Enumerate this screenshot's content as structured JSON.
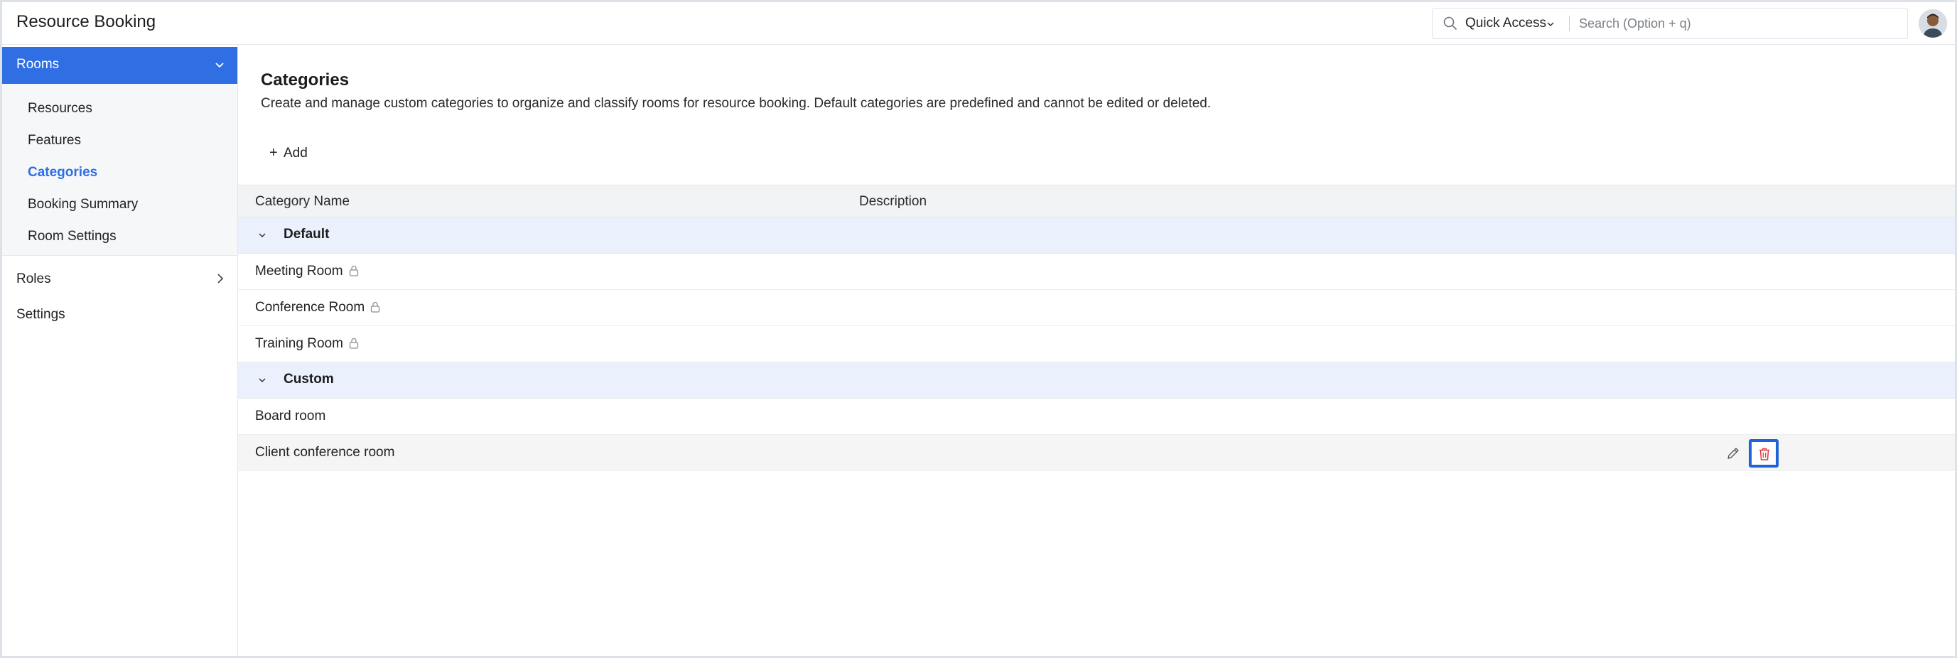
{
  "app": {
    "title": "Resource Booking"
  },
  "header": {
    "quick_access_label": "Quick Access",
    "search_placeholder": "Search (Option + q)"
  },
  "sidebar": {
    "active_section": "Rooms",
    "sub_items": [
      {
        "label": "Resources"
      },
      {
        "label": "Features"
      },
      {
        "label": "Categories",
        "active": true
      },
      {
        "label": "Booking Summary"
      },
      {
        "label": "Room Settings"
      }
    ],
    "items": [
      {
        "label": "Roles"
      },
      {
        "label": "Settings"
      }
    ]
  },
  "main": {
    "title": "Categories",
    "description": "Create and manage custom categories to organize and classify rooms for resource booking. Default categories are predefined and cannot be edited or deleted.",
    "add_label": "Add",
    "table": {
      "columns": [
        "Category Name",
        "Description"
      ],
      "groups": [
        {
          "label": "Default",
          "rows": [
            {
              "name": "Meeting Room",
              "description": "",
              "locked": true
            },
            {
              "name": "Conference Room",
              "description": "",
              "locked": true
            },
            {
              "name": "Training Room",
              "description": "",
              "locked": true
            }
          ]
        },
        {
          "label": "Custom",
          "rows": [
            {
              "name": "Board room",
              "description": "",
              "locked": false
            },
            {
              "name": "Client conference room",
              "description": "",
              "locked": false
            }
          ]
        }
      ]
    }
  },
  "colors": {
    "accent": "#2f6ee3",
    "group_row_bg": "#eaf1fc",
    "delete_icon": "#e0393e",
    "focus_border": "#1f63d6"
  },
  "icons": {
    "search": "search-icon",
    "chevron": "chevron-down-icon",
    "lock": "lock-icon",
    "edit": "pencil-icon",
    "delete": "trash-icon",
    "add": "plus-icon"
  }
}
